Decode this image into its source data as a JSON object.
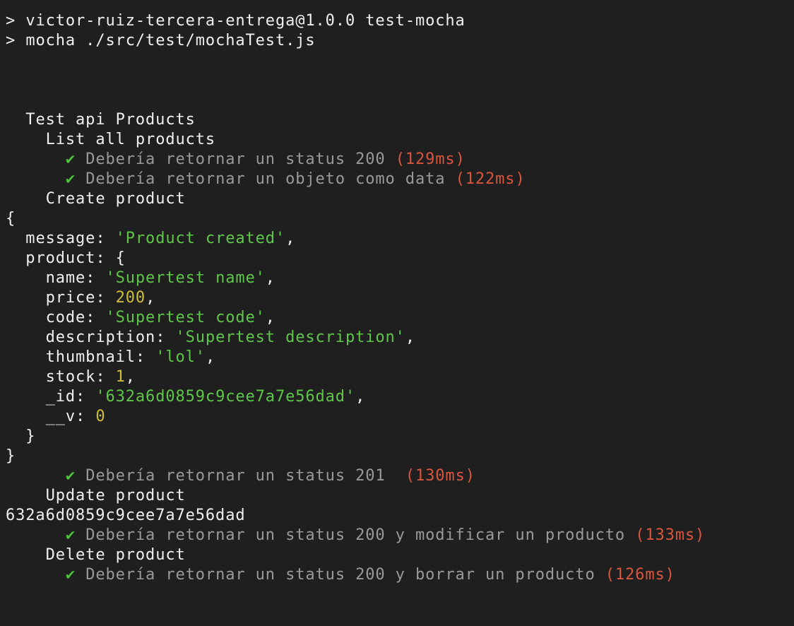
{
  "terminal": {
    "prompt": ">",
    "cmd_line1": "victor-ruiz-tercera-entrega@1.0.0 test-mocha",
    "cmd_line2": "mocha ./src/test/mochaTest.js",
    "suite_title": "Test api Products",
    "check_mark": "✔",
    "groups": {
      "list": {
        "title": "List all products",
        "tests": [
          {
            "label": "Debería retornar un status 200",
            "time": "(129ms)"
          },
          {
            "label": "Debería retornar un objeto como data",
            "time": "(122ms)"
          }
        ]
      },
      "create": {
        "title": "Create product",
        "tests": [
          {
            "label": "Debería retornar un status 201 ",
            "time": "(130ms)"
          }
        ]
      },
      "update": {
        "title": "Update product",
        "tests": [
          {
            "label": "Debería retornar un status 200 y modificar un producto",
            "time": "(133ms)"
          }
        ]
      },
      "delete": {
        "title": "Delete product",
        "tests": [
          {
            "label": "Debería retornar un status 200 y borrar un producto",
            "time": "(126ms)"
          }
        ]
      }
    },
    "log": {
      "open_brace": "{",
      "close_brace": "}",
      "inner_close_brace": "}",
      "message_key": "message: ",
      "message_value": "'Product created'",
      "product_key": "product: {",
      "fields": {
        "name_key": "name: ",
        "name_value": "'Supertest name'",
        "price_key": "price: ",
        "price_value": "200",
        "code_key": "code: ",
        "code_value": "'Supertest code'",
        "description_key": "description: ",
        "description_value": "'Supertest description'",
        "thumbnail_key": "thumbnail: ",
        "thumbnail_value": "'lol'",
        "stock_key": "stock: ",
        "stock_value": "1",
        "id_key": "_id: ",
        "id_value": "'632a6d0859c9cee7a7e56dad'",
        "v_key": "__v: ",
        "v_value": "0"
      },
      "comma": ","
    },
    "update_id": "632a6d0859c9cee7a7e56dad"
  },
  "colors": {
    "background": "#1f1f1f",
    "text": "#f0f0f0",
    "pass_check": "#4fc33f",
    "test_label": "#9a9a9a",
    "duration": "#d8563e",
    "string_value": "#5fc748",
    "number_value": "#cdbf3a"
  }
}
